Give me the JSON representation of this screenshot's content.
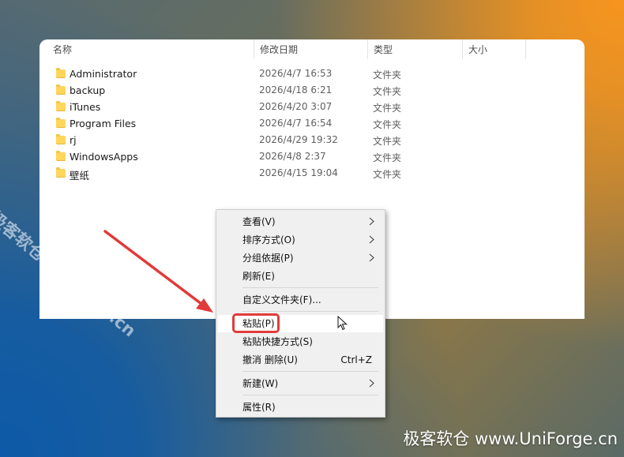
{
  "columns": {
    "name": "名称",
    "date": "修改日期",
    "type": "类型",
    "size": "大小"
  },
  "files": [
    {
      "name": "Administrator",
      "date": "2026/4/7 16:53",
      "type": "文件夹"
    },
    {
      "name": "backup",
      "date": "2026/4/18 6:21",
      "type": "文件夹"
    },
    {
      "name": "iTunes",
      "date": "2026/4/20 3:07",
      "type": "文件夹"
    },
    {
      "name": "Program Files",
      "date": "2026/4/7 16:54",
      "type": "文件夹"
    },
    {
      "name": "rj",
      "date": "2026/4/29 19:32",
      "type": "文件夹"
    },
    {
      "name": "WindowsApps",
      "date": "2026/4/8 2:37",
      "type": "文件夹"
    },
    {
      "name": "壁纸",
      "date": "2026/4/15 19:04",
      "type": "文件夹"
    }
  ],
  "menu": {
    "view": "查看(V)",
    "sort": "排序方式(O)",
    "group": "分组依据(P)",
    "refresh": "刷新(E)",
    "customize": "自定义文件夹(F)...",
    "paste": "粘贴(P)",
    "paste_shortcut": "粘贴快捷方式(S)",
    "undo": "撤消 删除(U)",
    "undo_shortcut": "Ctrl+Z",
    "new": "新建(W)",
    "properties": "属性(R)"
  },
  "watermark": {
    "diagonal": "极客软仓 UniForge.cn",
    "corner": "极客软仓 www.UniForge.cn"
  },
  "colors": {
    "highlight": "#e23b3b",
    "arrow": "#e03a3a",
    "folder": "#ffd65c"
  }
}
